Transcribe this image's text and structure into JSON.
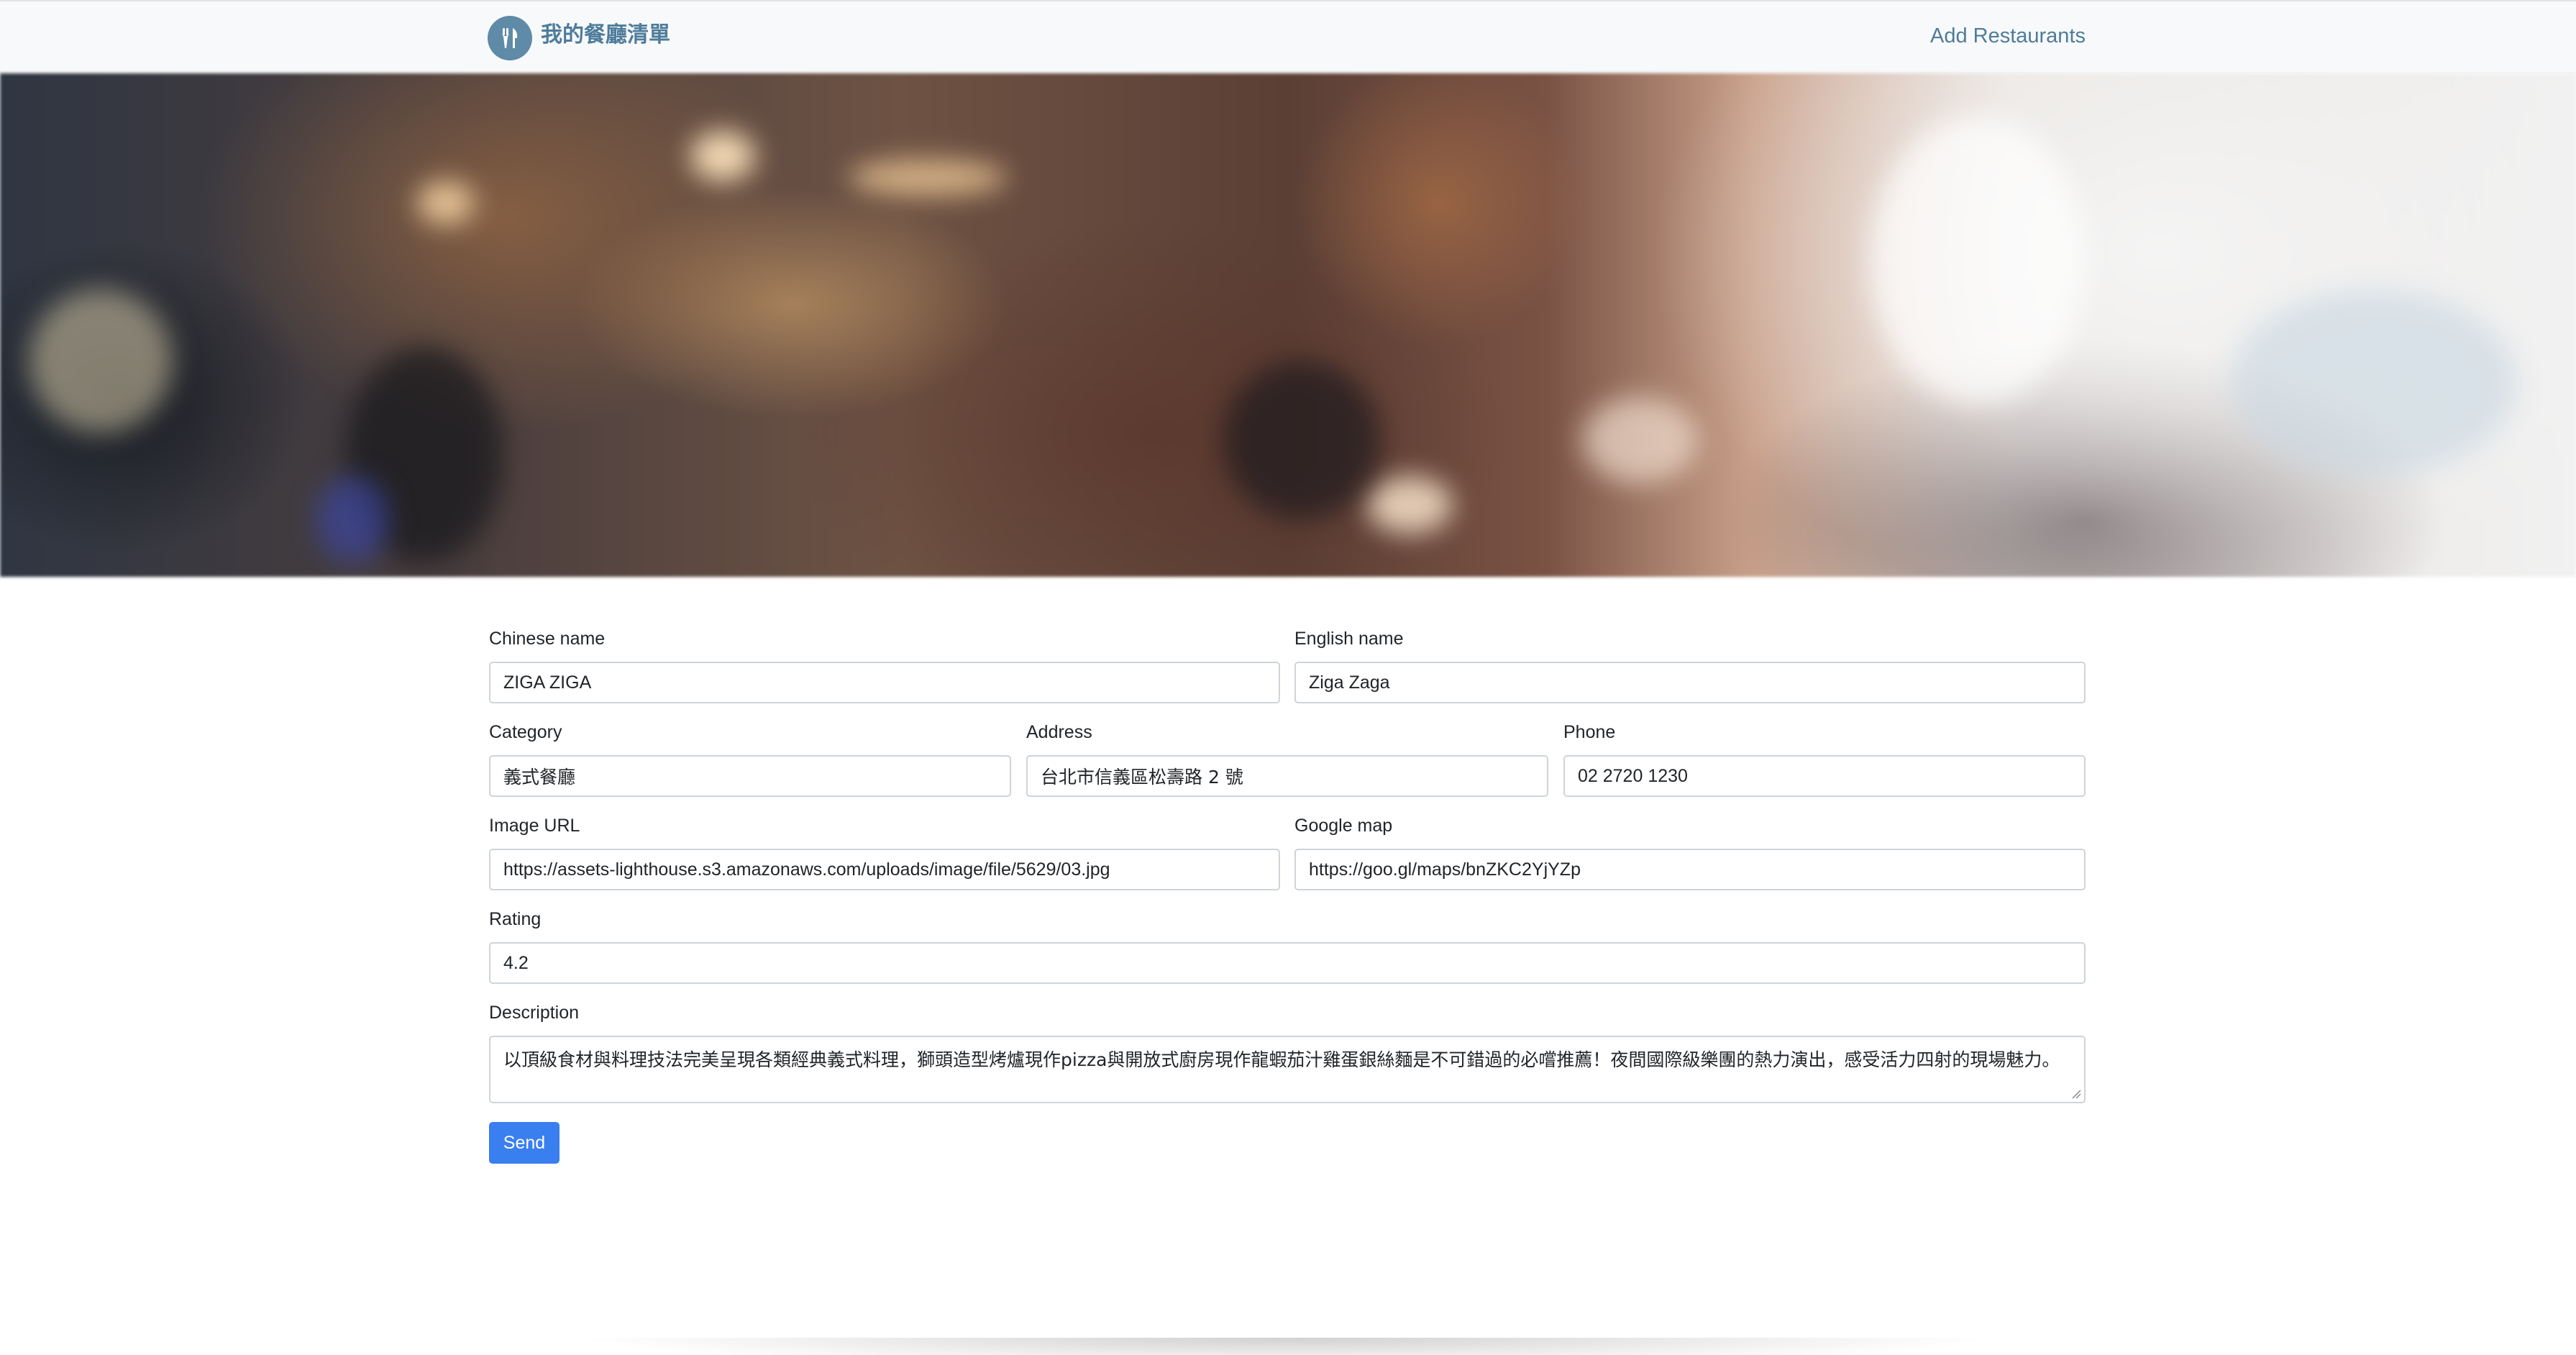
{
  "navbar": {
    "brand_title": "我的餐廳清單",
    "logo_icon": "utensils-icon",
    "add_link": "Add Restaurants"
  },
  "form": {
    "chinese_name": {
      "label": "Chinese name",
      "value": "ZIGA ZIGA"
    },
    "english_name": {
      "label": "English name",
      "value": "Ziga Zaga"
    },
    "category": {
      "label": "Category",
      "value": "義式餐廳"
    },
    "address": {
      "label": "Address",
      "value": "台北市信義區松壽路 2 號"
    },
    "phone": {
      "label": "Phone",
      "value": "02 2720 1230"
    },
    "image_url": {
      "label": "Image URL",
      "value": "https://assets-lighthouse.s3.amazonaws.com/uploads/image/file/5629/03.jpg"
    },
    "google_map": {
      "label": "Google map",
      "value": "https://goo.gl/maps/bnZKC2YjYZp"
    },
    "rating": {
      "label": "Rating",
      "value": "4.2"
    },
    "description": {
      "label": "Description",
      "value": "以頂級食材與料理技法完美呈現各類經典義式料理，獅頭造型烤爐現作pizza與開放式廚房現作龍蝦茄汁雞蛋銀絲麵是不可錯過的必嚐推薦！夜間國際級樂團的熱力演出，感受活力四射的現場魅力。"
    },
    "send_label": "Send"
  },
  "colors": {
    "brand": "#4e7c9b",
    "button": "#3a7ff0",
    "navbar_bg": "#f8f9fa"
  }
}
